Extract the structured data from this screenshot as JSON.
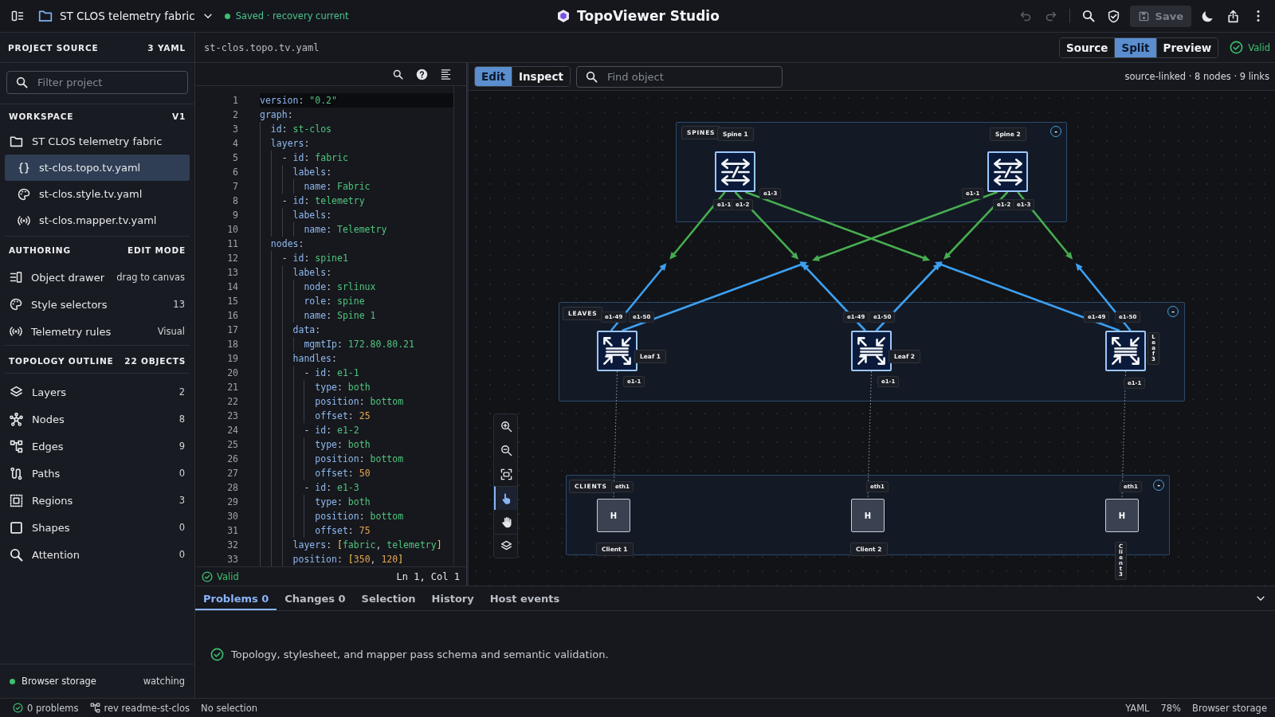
{
  "topbar": {
    "project": "ST CLOS telemetry fabric",
    "status": {
      "text": "Saved · recovery current",
      "ok": true
    },
    "title": "TopoViewer Studio",
    "undo": {
      "disabled": true
    },
    "redo": {
      "disabled": true
    },
    "save": {
      "label": "Save",
      "disabled": true
    }
  },
  "sidebar": {
    "source": {
      "title": "PROJECT SOURCE",
      "count": "3 YAML"
    },
    "filter": {
      "placeholder": "Filter project"
    },
    "workspace": {
      "title": "WORKSPACE",
      "version": "V1",
      "project": "ST CLOS telemetry fabric",
      "files": [
        {
          "kind": "topology",
          "name": "st-clos.topo.tv.yaml",
          "selected": true
        },
        {
          "kind": "style",
          "name": "st-clos.style.tv.yaml",
          "selected": false
        },
        {
          "kind": "mapper",
          "name": "st-clos.mapper.tv.yaml",
          "selected": false
        }
      ]
    },
    "authoring": {
      "title": "AUTHORING",
      "mode": "EDIT MODE",
      "items": [
        {
          "kind": "drawer",
          "label": "Object drawer",
          "value": "drag to canvas"
        },
        {
          "kind": "style",
          "label": "Style selectors",
          "value": "13"
        },
        {
          "kind": "telemetry",
          "label": "Telemetry rules",
          "value": "Visual"
        }
      ]
    },
    "outline": {
      "title": "TOPOLOGY OUTLINE",
      "count": "22 OBJECTS",
      "items": [
        {
          "kind": "layers",
          "label": "Layers",
          "count": "2"
        },
        {
          "kind": "nodes",
          "label": "Nodes",
          "count": "8"
        },
        {
          "kind": "edges",
          "label": "Edges",
          "count": "9"
        },
        {
          "kind": "paths",
          "label": "Paths",
          "count": "0"
        },
        {
          "kind": "regions",
          "label": "Regions",
          "count": "3"
        },
        {
          "kind": "shapes",
          "label": "Shapes",
          "count": "0"
        },
        {
          "kind": "attention",
          "label": "Attention",
          "count": "0"
        }
      ]
    },
    "storage": {
      "label": "Browser storage",
      "state": "watching",
      "active": true
    }
  },
  "header": {
    "file": "st-clos.topo.tv.yaml",
    "modes": [
      {
        "label": "Source",
        "selected": false
      },
      {
        "label": "Split",
        "selected": true
      },
      {
        "label": "Preview",
        "selected": false
      }
    ],
    "validity": {
      "label": "Valid",
      "valid": true
    }
  },
  "editor": {
    "lines": [
      {
        "number": "1",
        "text": "version: \"0.2\"",
        "current": true
      },
      {
        "number": "2",
        "text": "graph:",
        "current": false
      },
      {
        "number": "3",
        "text": "  id: st-clos",
        "current": false
      },
      {
        "number": "4",
        "text": "  layers:",
        "current": false
      },
      {
        "number": "5",
        "text": "    - id: fabric",
        "current": false
      },
      {
        "number": "6",
        "text": "      labels:",
        "current": false
      },
      {
        "number": "7",
        "text": "        name: Fabric",
        "current": false
      },
      {
        "number": "8",
        "text": "    - id: telemetry",
        "current": false
      },
      {
        "number": "9",
        "text": "      labels:",
        "current": false
      },
      {
        "number": "10",
        "text": "        name: Telemetry",
        "current": false
      },
      {
        "number": "11",
        "text": "  nodes:",
        "current": false
      },
      {
        "number": "12",
        "text": "    - id: spine1",
        "current": false
      },
      {
        "number": "13",
        "text": "      labels:",
        "current": false
      },
      {
        "number": "14",
        "text": "        node: srlinux",
        "current": false
      },
      {
        "number": "15",
        "text": "        role: spine",
        "current": false
      },
      {
        "number": "16",
        "text": "        name: Spine 1",
        "current": false
      },
      {
        "number": "17",
        "text": "      data:",
        "current": false
      },
      {
        "number": "18",
        "text": "        mgmtIp: 172.80.80.21",
        "current": false
      },
      {
        "number": "19",
        "text": "      handles:",
        "current": false
      },
      {
        "number": "20",
        "text": "        - id: e1-1",
        "current": false
      },
      {
        "number": "21",
        "text": "          type: both",
        "current": false
      },
      {
        "number": "22",
        "text": "          position: bottom",
        "current": false
      },
      {
        "number": "23",
        "text": "          offset: 25",
        "current": false
      },
      {
        "number": "24",
        "text": "        - id: e1-2",
        "current": false
      },
      {
        "number": "25",
        "text": "          type: both",
        "current": false
      },
      {
        "number": "26",
        "text": "          position: bottom",
        "current": false
      },
      {
        "number": "27",
        "text": "          offset: 50",
        "current": false
      },
      {
        "number": "28",
        "text": "        - id: e1-3",
        "current": false
      },
      {
        "number": "29",
        "text": "          type: both",
        "current": false
      },
      {
        "number": "30",
        "text": "          position: bottom",
        "current": false
      },
      {
        "number": "31",
        "text": "          offset: 75",
        "current": false
      },
      {
        "number": "32",
        "text": "      layers: [fabric, telemetry]",
        "current": false
      },
      {
        "number": "33",
        "text": "      position: [350, 120]",
        "current": false
      }
    ],
    "status": {
      "label": "Valid",
      "valid": true
    },
    "cursor": "Ln 1, Col 1"
  },
  "canvas": {
    "modes": [
      {
        "label": "Edit",
        "selected": true
      },
      {
        "label": "Inspect",
        "selected": false
      }
    ],
    "search": {
      "placeholder": "Find object"
    },
    "summary": "source-linked · 8 nodes · 9 links",
    "controls": [
      {
        "kind": "zoom-in",
        "selected": false
      },
      {
        "kind": "zoom-out",
        "selected": false
      },
      {
        "kind": "fit",
        "selected": false
      },
      {
        "kind": "select",
        "selected": true
      },
      {
        "kind": "pan",
        "selected": false
      },
      {
        "kind": "layers",
        "selected": false
      }
    ],
    "regions": [
      {
        "label": "SPINES",
        "toggle": "-",
        "nodes": [
          {
            "kind": "spine",
            "label": "Spine 1",
            "handles": [
              "e1-1",
              "e1-2",
              "e1-3"
            ]
          },
          {
            "kind": "spine",
            "label": "Spine 2",
            "handles": [
              "e1-1",
              "e1-2",
              "e1-3"
            ]
          }
        ]
      },
      {
        "label": "LEAVES",
        "toggle": "-",
        "nodes": [
          {
            "kind": "leaf",
            "label": "Leaf 1",
            "handles": [
              "e1-49",
              "e1-50",
              "e1-1"
            ]
          },
          {
            "kind": "leaf",
            "label": "Leaf 2",
            "handles": [
              "e1-49",
              "e1-50",
              "e1-1"
            ]
          },
          {
            "kind": "leaf",
            "label": "Leaf 3",
            "handles": [
              "e1-49",
              "e1-50",
              "e1-1"
            ]
          }
        ]
      },
      {
        "label": "CLIENTS",
        "toggle": "-",
        "nodes": [
          {
            "kind": "client",
            "label": "Client 1",
            "glyph": "H",
            "handles": [
              "eth1"
            ]
          },
          {
            "kind": "client",
            "label": "Client 2",
            "glyph": "H",
            "handles": [
              "eth1"
            ]
          },
          {
            "kind": "client",
            "label": "Client 3",
            "glyph": "H",
            "handles": [
              "eth1"
            ]
          }
        ]
      }
    ],
    "links": [
      {
        "kind": "telemetry"
      },
      {
        "kind": "telemetry"
      },
      {
        "kind": "telemetry"
      },
      {
        "kind": "telemetry"
      },
      {
        "kind": "telemetry"
      },
      {
        "kind": "telemetry"
      },
      {
        "kind": "access"
      },
      {
        "kind": "access"
      },
      {
        "kind": "access"
      }
    ]
  },
  "panel": {
    "tabs": [
      {
        "label": "Problems 0",
        "selected": true
      },
      {
        "label": "Changes 0",
        "selected": false
      },
      {
        "label": "Selection",
        "selected": false
      },
      {
        "label": "History",
        "selected": false
      },
      {
        "label": "Host events",
        "selected": false
      }
    ],
    "message": {
      "text": "Topology, stylesheet, and mapper pass schema and semantic validation.",
      "ok": true
    }
  },
  "status_bar": {
    "problems": "0 problems",
    "revision": "rev readme-st-clos",
    "selection": "No selection",
    "language": "YAML",
    "zoom": "78%",
    "storage": "Browser storage"
  }
}
